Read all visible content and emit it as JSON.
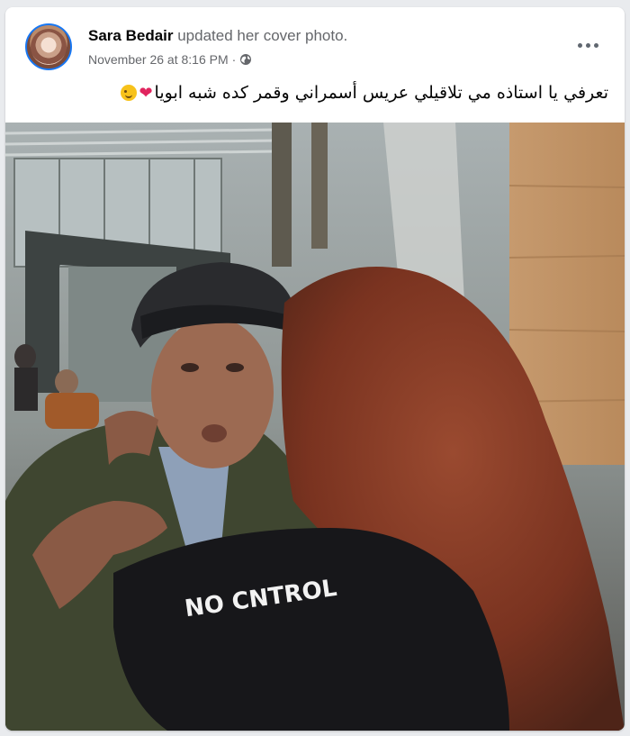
{
  "post": {
    "author": "Sara Bedair",
    "action": " updated her cover photo.",
    "timestamp": "November 26 at 8:16 PM",
    "separator": "·",
    "caption_text": "تعرفي يا استاذه مي تلاقيلي عريس أسمراني وقمر كده شبه ابويا",
    "caption_heart": "❤",
    "privacy_icon": "globe-icon",
    "more_icon": "more-options-icon"
  },
  "photo": {
    "shirt_text": "NO CNTROL"
  },
  "colors": {
    "accent": "#1877f2",
    "name": "#050505",
    "secondary": "#65676b",
    "card": "#ffffff",
    "page": "#e9ebee"
  }
}
